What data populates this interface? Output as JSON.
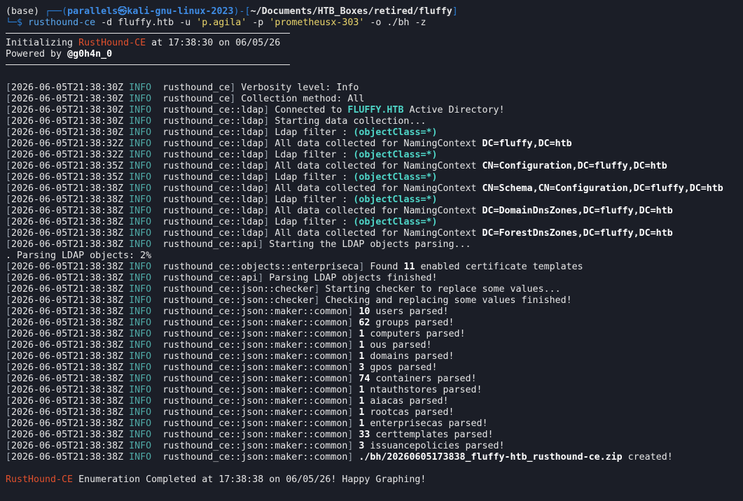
{
  "prompt": {
    "env": "(base) ",
    "corner_top": "┌──(",
    "user": "parallels㉿kali-gnu-linux-2023",
    "close_paren": ")-[",
    "path": "~/Documents/HTB_Boxes/retired/fluffy",
    "close_bracket": "]",
    "corner_bottom": "└─$ ",
    "cmd": "rusthound-ce",
    "arg1": " -d fluffy.htb -u ",
    "user_arg": "'p.agila'",
    "arg2": " -p ",
    "pass_arg": "'prometheusx-303'",
    "arg3": " -o ./bh -z"
  },
  "banner": {
    "init_prefix": "Initializing ",
    "brand": "RustHound-CE",
    "init_suffix": " at 17:38:30 on 06/05/26",
    "powered_prefix": "Powered by ",
    "powered_by": "@g0h4n_0"
  },
  "log": [
    {
      "ts": "2026-06-05T21:38:30Z",
      "lvl": "INFO",
      "mod": "rusthound_ce",
      "pre": "Verbosity level: Info",
      "hl": "",
      "hl_class": "",
      "post": ""
    },
    {
      "ts": "2026-06-05T21:38:30Z",
      "lvl": "INFO",
      "mod": "rusthound_ce",
      "pre": "Collection method: All",
      "hl": "",
      "hl_class": "",
      "post": ""
    },
    {
      "ts": "2026-06-05T21:38:30Z",
      "lvl": "INFO",
      "mod": "rusthound_ce::ldap",
      "pre": "Connected to ",
      "hl": "FLUFFY.HTB",
      "hl_class": "c-cyan",
      "post": " Active Directory!"
    },
    {
      "ts": "2026-06-05T21:38:30Z",
      "lvl": "INFO",
      "mod": "rusthound_ce::ldap",
      "pre": "Starting data collection...",
      "hl": "",
      "hl_class": "",
      "post": ""
    },
    {
      "ts": "2026-06-05T21:38:30Z",
      "lvl": "INFO",
      "mod": "rusthound_ce::ldap",
      "pre": "Ldap filter : ",
      "hl": "(objectClass=*)",
      "hl_class": "c-cyan",
      "post": ""
    },
    {
      "ts": "2026-06-05T21:38:32Z",
      "lvl": "INFO",
      "mod": "rusthound_ce::ldap",
      "pre": "All data collected for NamingContext ",
      "hl": "DC=fluffy,DC=htb",
      "hl_class": "c-bold",
      "post": ""
    },
    {
      "ts": "2026-06-05T21:38:32Z",
      "lvl": "INFO",
      "mod": "rusthound_ce::ldap",
      "pre": "Ldap filter : ",
      "hl": "(objectClass=*)",
      "hl_class": "c-cyan",
      "post": ""
    },
    {
      "ts": "2026-06-05T21:38:35Z",
      "lvl": "INFO",
      "mod": "rusthound_ce::ldap",
      "pre": "All data collected for NamingContext ",
      "hl": "CN=Configuration,DC=fluffy,DC=htb",
      "hl_class": "c-bold",
      "post": ""
    },
    {
      "ts": "2026-06-05T21:38:35Z",
      "lvl": "INFO",
      "mod": "rusthound_ce::ldap",
      "pre": "Ldap filter : ",
      "hl": "(objectClass=*)",
      "hl_class": "c-cyan",
      "post": ""
    },
    {
      "ts": "2026-06-05T21:38:38Z",
      "lvl": "INFO",
      "mod": "rusthound_ce::ldap",
      "pre": "All data collected for NamingContext ",
      "hl": "CN=Schema,CN=Configuration,DC=fluffy,DC=htb",
      "hl_class": "c-bold",
      "post": ""
    },
    {
      "ts": "2026-06-05T21:38:38Z",
      "lvl": "INFO",
      "mod": "rusthound_ce::ldap",
      "pre": "Ldap filter : ",
      "hl": "(objectClass=*)",
      "hl_class": "c-cyan",
      "post": ""
    },
    {
      "ts": "2026-06-05T21:38:38Z",
      "lvl": "INFO",
      "mod": "rusthound_ce::ldap",
      "pre": "All data collected for NamingContext ",
      "hl": "DC=DomainDnsZones,DC=fluffy,DC=htb",
      "hl_class": "c-bold",
      "post": ""
    },
    {
      "ts": "2026-06-05T21:38:38Z",
      "lvl": "INFO",
      "mod": "rusthound_ce::ldap",
      "pre": "Ldap filter : ",
      "hl": "(objectClass=*)",
      "hl_class": "c-cyan",
      "post": ""
    },
    {
      "ts": "2026-06-05T21:38:38Z",
      "lvl": "INFO",
      "mod": "rusthound_ce::ldap",
      "pre": "All data collected for NamingContext ",
      "hl": "DC=ForestDnsZones,DC=fluffy,DC=htb",
      "hl_class": "c-bold",
      "post": ""
    },
    {
      "ts": "2026-06-05T21:38:38Z",
      "lvl": "INFO",
      "mod": "rusthound_ce::api",
      "pre": "Starting the LDAP objects parsing...",
      "hl": "",
      "hl_class": "",
      "post": ""
    }
  ],
  "progress_line": ". Parsing LDAP objects: 2%",
  "log2": [
    {
      "ts": "2026-06-05T21:38:38Z",
      "lvl": "INFO",
      "mod": "rusthound_ce::objects::enterpriseca",
      "pre": "Found ",
      "hl": "11",
      "hl_class": "c-bold",
      "post": " enabled certificate templates"
    },
    {
      "ts": "2026-06-05T21:38:38Z",
      "lvl": "INFO",
      "mod": "rusthound_ce::api",
      "pre": "Parsing LDAP objects finished!",
      "hl": "",
      "hl_class": "",
      "post": ""
    },
    {
      "ts": "2026-06-05T21:38:38Z",
      "lvl": "INFO",
      "mod": "rusthound_ce::json::checker",
      "pre": "Starting checker to replace some values...",
      "hl": "",
      "hl_class": "",
      "post": ""
    },
    {
      "ts": "2026-06-05T21:38:38Z",
      "lvl": "INFO",
      "mod": "rusthound_ce::json::checker",
      "pre": "Checking and replacing some values finished!",
      "hl": "",
      "hl_class": "",
      "post": ""
    },
    {
      "ts": "2026-06-05T21:38:38Z",
      "lvl": "INFO",
      "mod": "rusthound_ce::json::maker::common",
      "pre": "",
      "hl": "10",
      "hl_class": "c-bold",
      "post": " users parsed!"
    },
    {
      "ts": "2026-06-05T21:38:38Z",
      "lvl": "INFO",
      "mod": "rusthound_ce::json::maker::common",
      "pre": "",
      "hl": "62",
      "hl_class": "c-bold",
      "post": " groups parsed!"
    },
    {
      "ts": "2026-06-05T21:38:38Z",
      "lvl": "INFO",
      "mod": "rusthound_ce::json::maker::common",
      "pre": "",
      "hl": "1",
      "hl_class": "c-bold",
      "post": " computers parsed!"
    },
    {
      "ts": "2026-06-05T21:38:38Z",
      "lvl": "INFO",
      "mod": "rusthound_ce::json::maker::common",
      "pre": "",
      "hl": "1",
      "hl_class": "c-bold",
      "post": " ous parsed!"
    },
    {
      "ts": "2026-06-05T21:38:38Z",
      "lvl": "INFO",
      "mod": "rusthound_ce::json::maker::common",
      "pre": "",
      "hl": "1",
      "hl_class": "c-bold",
      "post": " domains parsed!"
    },
    {
      "ts": "2026-06-05T21:38:38Z",
      "lvl": "INFO",
      "mod": "rusthound_ce::json::maker::common",
      "pre": "",
      "hl": "3",
      "hl_class": "c-bold",
      "post": " gpos parsed!"
    },
    {
      "ts": "2026-06-05T21:38:38Z",
      "lvl": "INFO",
      "mod": "rusthound_ce::json::maker::common",
      "pre": "",
      "hl": "74",
      "hl_class": "c-bold",
      "post": " containers parsed!"
    },
    {
      "ts": "2026-06-05T21:38:38Z",
      "lvl": "INFO",
      "mod": "rusthound_ce::json::maker::common",
      "pre": "",
      "hl": "1",
      "hl_class": "c-bold",
      "post": " ntauthstores parsed!"
    },
    {
      "ts": "2026-06-05T21:38:38Z",
      "lvl": "INFO",
      "mod": "rusthound_ce::json::maker::common",
      "pre": "",
      "hl": "1",
      "hl_class": "c-bold",
      "post": " aiacas parsed!"
    },
    {
      "ts": "2026-06-05T21:38:38Z",
      "lvl": "INFO",
      "mod": "rusthound_ce::json::maker::common",
      "pre": "",
      "hl": "1",
      "hl_class": "c-bold",
      "post": " rootcas parsed!"
    },
    {
      "ts": "2026-06-05T21:38:38Z",
      "lvl": "INFO",
      "mod": "rusthound_ce::json::maker::common",
      "pre": "",
      "hl": "1",
      "hl_class": "c-bold",
      "post": " enterprisecas parsed!"
    },
    {
      "ts": "2026-06-05T21:38:38Z",
      "lvl": "INFO",
      "mod": "rusthound_ce::json::maker::common",
      "pre": "",
      "hl": "33",
      "hl_class": "c-bold",
      "post": " certtemplates parsed!"
    },
    {
      "ts": "2026-06-05T21:38:38Z",
      "lvl": "INFO",
      "mod": "rusthound_ce::json::maker::common",
      "pre": "",
      "hl": "3",
      "hl_class": "c-bold",
      "post": " issuancepolicies parsed!"
    },
    {
      "ts": "2026-06-05T21:38:38Z",
      "lvl": "INFO",
      "mod": "rusthound_ce::json::maker::common",
      "pre": "",
      "hl": "./bh/20260605173838_fluffy-htb_rusthound-ce.zip",
      "hl_class": "c-bold",
      "post": " created!"
    }
  ],
  "footer": {
    "brand": "RustHound-CE",
    "text": " Enumeration Completed at 17:38:38 on 06/05/26! Happy Graphing!"
  },
  "colors": {
    "background": "#1b1e27",
    "brand": "#e0502d",
    "info": "#4fa9a6",
    "highlight_cyan": "#4fd6c8",
    "prompt_blue": "#3f8de6",
    "string_yellow": "#e8d36a"
  }
}
